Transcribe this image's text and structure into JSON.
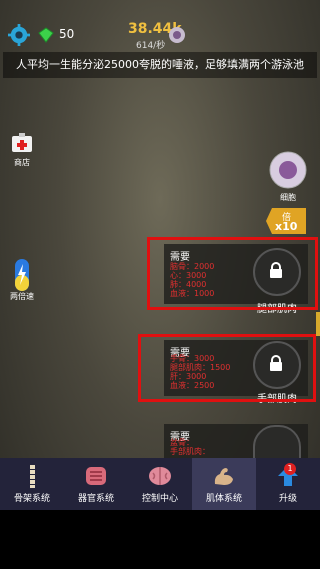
{
  "header": {
    "gem_count": "50",
    "currency": "38.44k",
    "rate": "614/秒"
  },
  "banner": {
    "text": "人平均一生能分泌25000夸脱的唾液，足够填满两个游泳池"
  },
  "left_buttons": {
    "shop_label": "商店",
    "speed_label": "两倍速"
  },
  "right_buttons": {
    "cell_label": "细胞",
    "multiplier_top": "倍",
    "multiplier_value": "x10"
  },
  "cards": [
    {
      "title": "需要",
      "requirements": [
        "脑骨：2000",
        "心：3000",
        "肺：4000",
        "血液：1000"
      ],
      "part_label": "腿部肌肉"
    },
    {
      "title": "需要",
      "requirements": [
        "手骨：3000",
        "腿部肌肉：1500",
        "肝：3000",
        "血液：2500"
      ],
      "part_label": "手部肌肉"
    },
    {
      "title": "需要",
      "requirements": [
        "盆骨：",
        "手部肌肉："
      ],
      "part_label": ""
    }
  ],
  "nav": {
    "items": [
      {
        "label": "骨架系统",
        "icon": "spine-icon"
      },
      {
        "label": "器官系统",
        "icon": "intestine-icon"
      },
      {
        "label": "控制中心",
        "icon": "brain-icon"
      },
      {
        "label": "肌体系统",
        "icon": "muscle-arm-icon"
      },
      {
        "label": "升级",
        "icon": "upgrade-arrow-icon"
      }
    ],
    "badge_count": "1",
    "active_index": 3
  },
  "colors": {
    "currency": "#f0c040",
    "requirement_text": "#e03030",
    "highlight": "#e01010",
    "nav_background": "#23233a"
  }
}
